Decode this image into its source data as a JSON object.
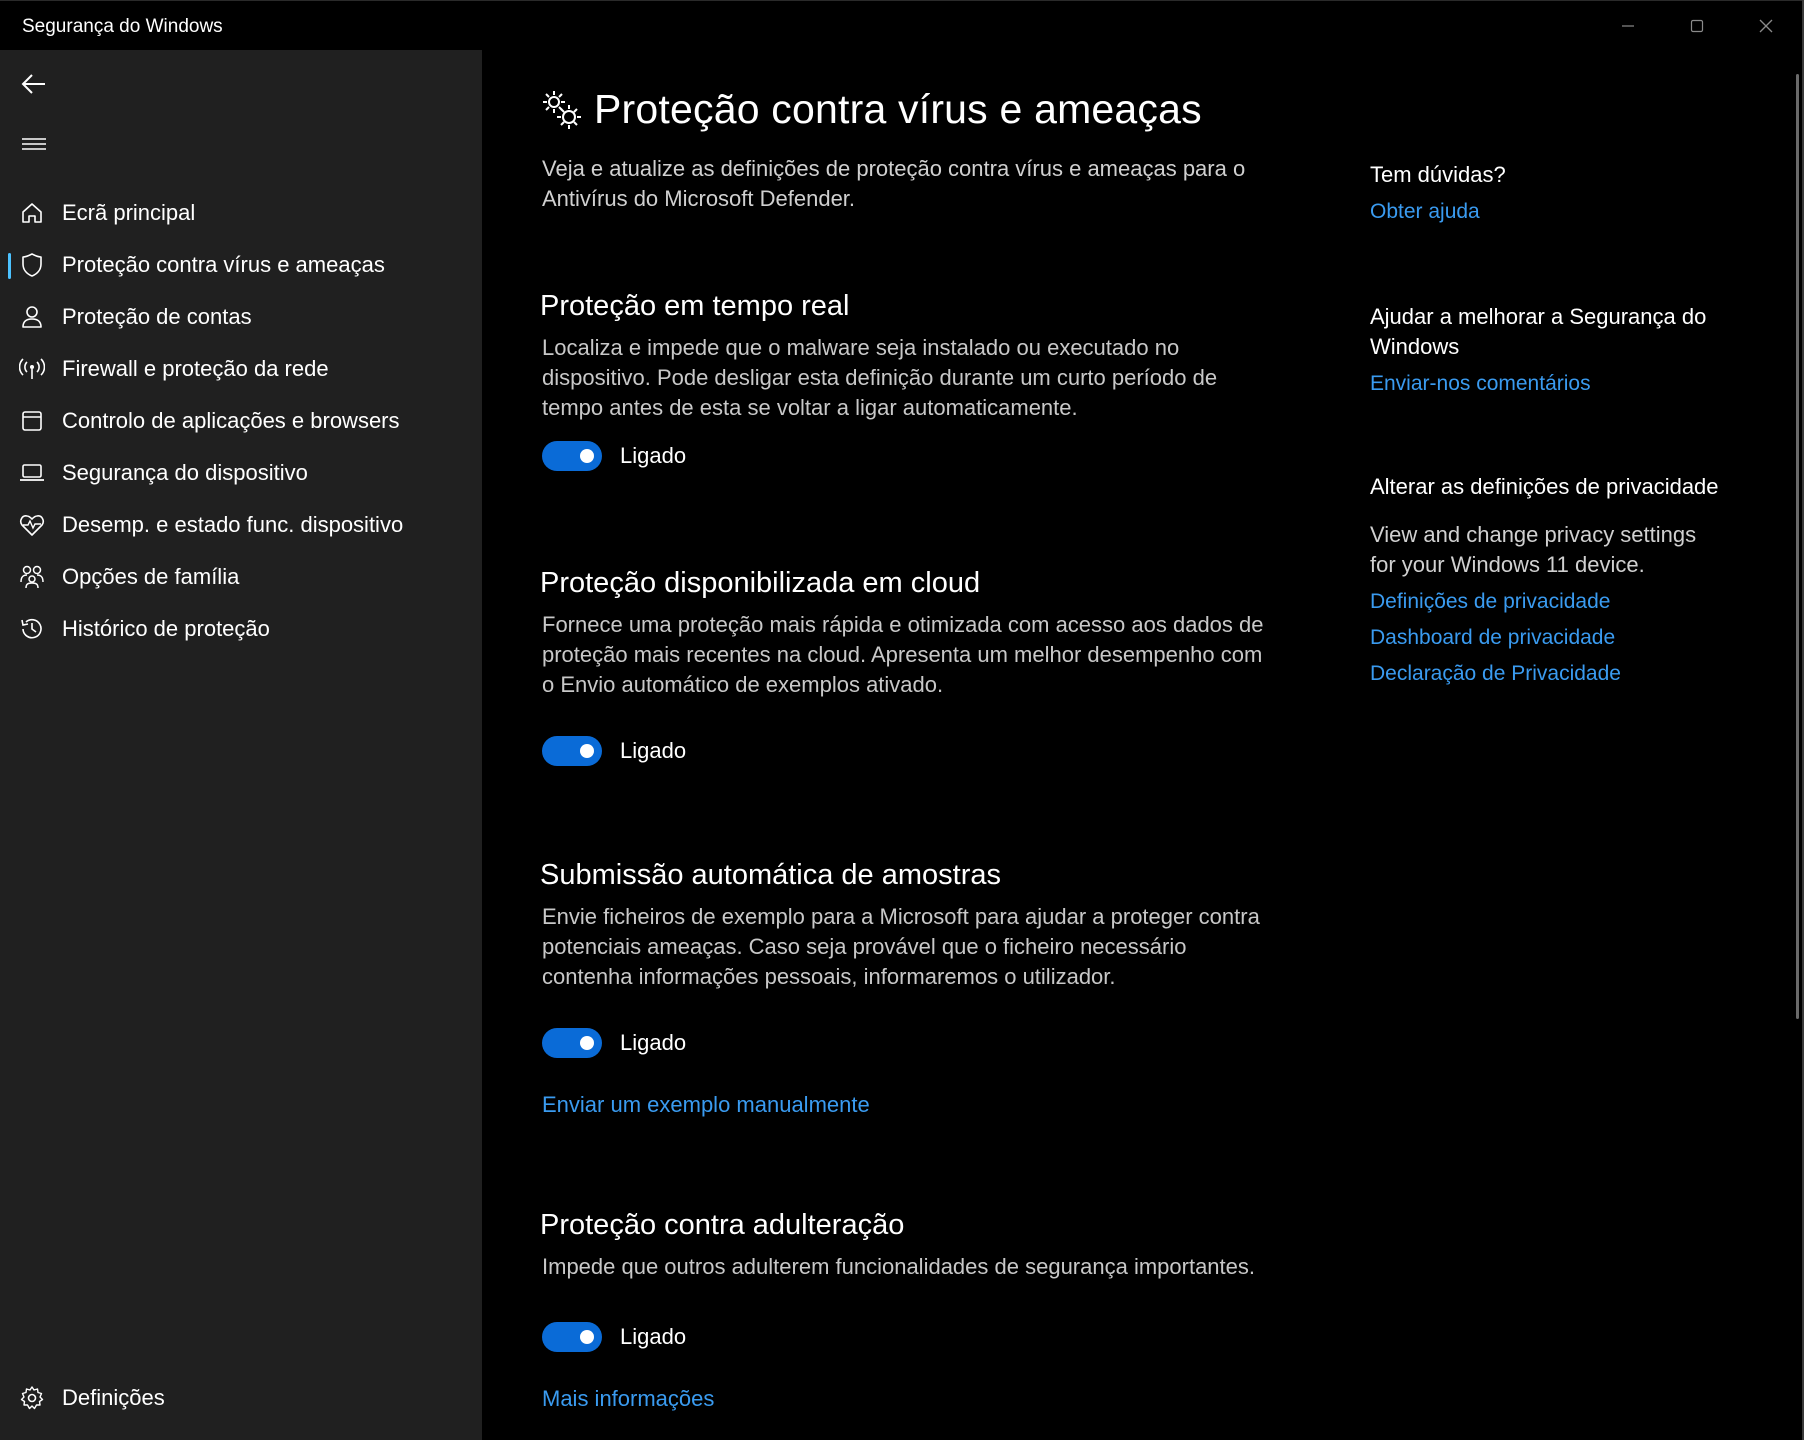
{
  "window": {
    "title": "Segurança do Windows",
    "controls": [
      "minimize-icon",
      "maximize-icon",
      "close-icon"
    ]
  },
  "sidebar": {
    "back_icon": "back-arrow-icon",
    "menu_icon": "hamburger-menu-icon",
    "items": [
      {
        "label": "Ecrã principal",
        "icon": "home-icon",
        "selected": false
      },
      {
        "label": "Proteção contra vírus e ameaças",
        "icon": "shield-icon",
        "selected": true
      },
      {
        "label": "Proteção de contas",
        "icon": "person-icon",
        "selected": false
      },
      {
        "label": "Firewall e proteção da rede",
        "icon": "wireless-icon",
        "selected": false
      },
      {
        "label": "Controlo de aplicações e browsers",
        "icon": "app-window-icon",
        "selected": false
      },
      {
        "label": "Segurança do dispositivo",
        "icon": "laptop-icon",
        "selected": false
      },
      {
        "label": "Desemp. e estado func. dispositivo",
        "icon": "heart-pulse-icon",
        "selected": false
      },
      {
        "label": "Opções de família",
        "icon": "family-icon",
        "selected": false
      },
      {
        "label": "Histórico de proteção",
        "icon": "history-icon",
        "selected": false
      }
    ],
    "settings": {
      "label": "Definições",
      "icon": "gear-icon"
    }
  },
  "main": {
    "header_icon": "virus-gears-icon",
    "title": "Proteção contra vírus e ameaças",
    "description": "Veja e atualize as definições de proteção contra vírus e ameaças para o Antivírus do Microsoft Defender.",
    "sections": [
      {
        "title": "Proteção em tempo real",
        "description": "Localiza e impede que o malware seja instalado ou executado no dispositivo. Pode desligar esta definição durante um curto período de tempo antes de esta se voltar a ligar automaticamente.",
        "toggle_label": "Ligado",
        "toggle_on": true
      },
      {
        "title": "Proteção disponibilizada em cloud",
        "description": "Fornece uma proteção mais rápida e otimizada com acesso aos dados de proteção mais recentes na cloud. Apresenta um melhor desempenho com o Envio automático de exemplos ativado.",
        "toggle_label": "Ligado",
        "toggle_on": true
      },
      {
        "title": "Submissão automática de amostras",
        "description": "Envie ficheiros de exemplo para a Microsoft para ajudar a proteger contra potenciais ameaças. Caso seja provável que o ficheiro necessário contenha informações pessoais, informaremos o utilizador.",
        "toggle_label": "Ligado",
        "toggle_on": true,
        "link": "Enviar um exemplo manualmente"
      },
      {
        "title": "Proteção contra adulteração",
        "description": "Impede que outros adulterem funcionalidades de segurança importantes.",
        "toggle_label": "Ligado",
        "toggle_on": true,
        "link": "Mais informações"
      }
    ]
  },
  "side_pane": {
    "help_heading": "Tem dúvidas?",
    "help_link": "Obter ajuda",
    "feedback_heading": "Ajudar a melhorar a Segurança do Windows",
    "feedback_link": "Enviar-nos comentários",
    "privacy_heading": "Alterar as definições de privacidade",
    "privacy_text": "View and change privacy settings for your Windows 11 device.",
    "privacy_links": [
      "Definições de privacidade",
      "Dashboard de privacidade",
      "Declaração de Privacidade"
    ]
  },
  "colors": {
    "accent": "#0a6bd7",
    "link": "#3a9bf0",
    "sidebar_bg": "#202020",
    "main_bg": "#000000",
    "selected_indicator": "#4cc2ff"
  }
}
